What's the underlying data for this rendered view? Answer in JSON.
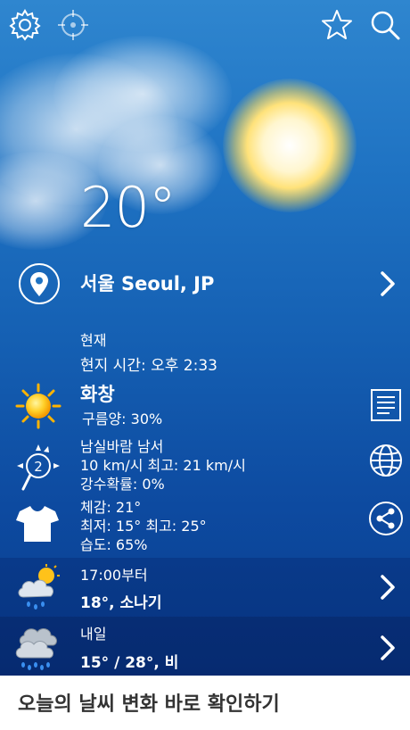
{
  "top_bar": {
    "icons": [
      "gear-icon",
      "location-target-icon",
      "star-icon",
      "search-icon"
    ]
  },
  "current": {
    "temperature": "20°",
    "location": "서울 Seoul, JP",
    "now_label": "현재",
    "local_time": "현지 시간: 오후 2:33",
    "condition": "화창",
    "cloud_cover": "구름양: 30%",
    "wind_direction": "남실바람 남서",
    "wind_speed": "10 km/시 최고: 21 km/시",
    "precip_chance": "강수확률: 0%",
    "wind_badge": "2",
    "feels_like": "체감: 21°",
    "min_max": "최저: 15°  최고: 25°",
    "humidity": "습도: 65%"
  },
  "forecast": [
    {
      "title": "17:00부터",
      "detail": "18°, 소나기",
      "icon": "sun-cloud-rain-icon"
    },
    {
      "title": "내일",
      "detail": "15° / 28°, 비",
      "icon": "cloud-rain-icon"
    }
  ],
  "side_buttons": [
    "document-icon",
    "globe-icon",
    "share-icon"
  ],
  "banner": {
    "text": "오늘의 날씨 변화 바로 확인하기"
  },
  "colors": {
    "sky_top": "#2f86cf",
    "sky_bottom": "#0a3d8d",
    "sun": "#ffd23a",
    "banner_text": "#333333"
  }
}
